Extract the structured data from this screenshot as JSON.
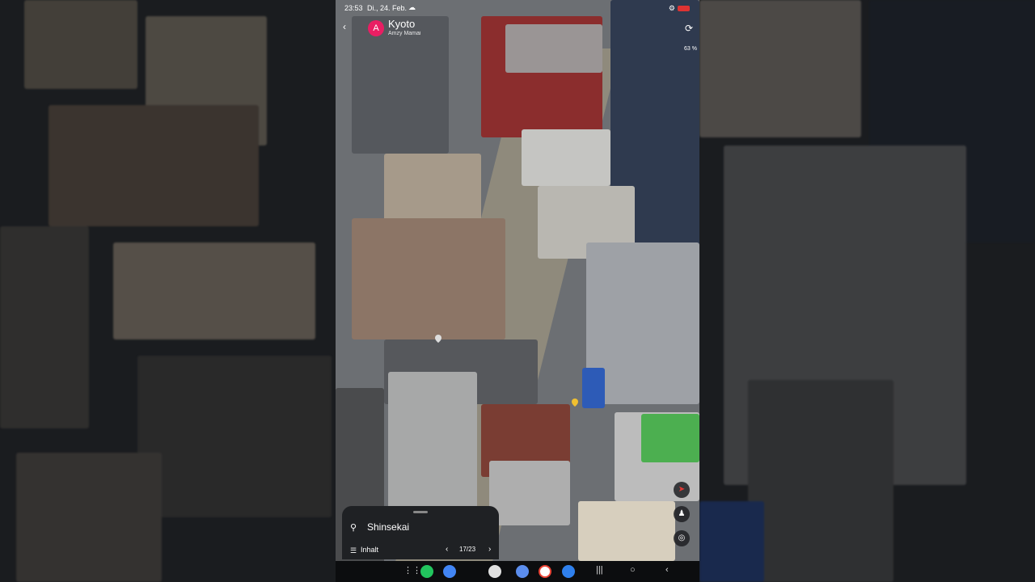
{
  "status_bar": {
    "time": "23:53",
    "date": "Di., 24. Feb."
  },
  "header": {
    "title": "Kyoto",
    "subtitle": "Amzy Mamai",
    "avatar_letter": "A"
  },
  "zoom_level": "63 %",
  "sheet": {
    "place_name": "Shinsekai",
    "content_label": "Inhalt",
    "pager": "17/23"
  },
  "colors": {
    "avatar": "#e91e63",
    "sheet_bg": "#1f2124",
    "accent_green": "#4caf50"
  },
  "icons": [
    "back-icon",
    "refresh-icon",
    "location-pin-icon",
    "list-icon",
    "chevron-left-icon",
    "chevron-right-icon",
    "compass-icon",
    "pegman-icon",
    "my-location-icon",
    "app-grid-icon",
    "phone-icon",
    "chrome-icon",
    "camera-icon",
    "gmail-icon",
    "recents-icon",
    "home-icon",
    "back-nav-icon"
  ]
}
